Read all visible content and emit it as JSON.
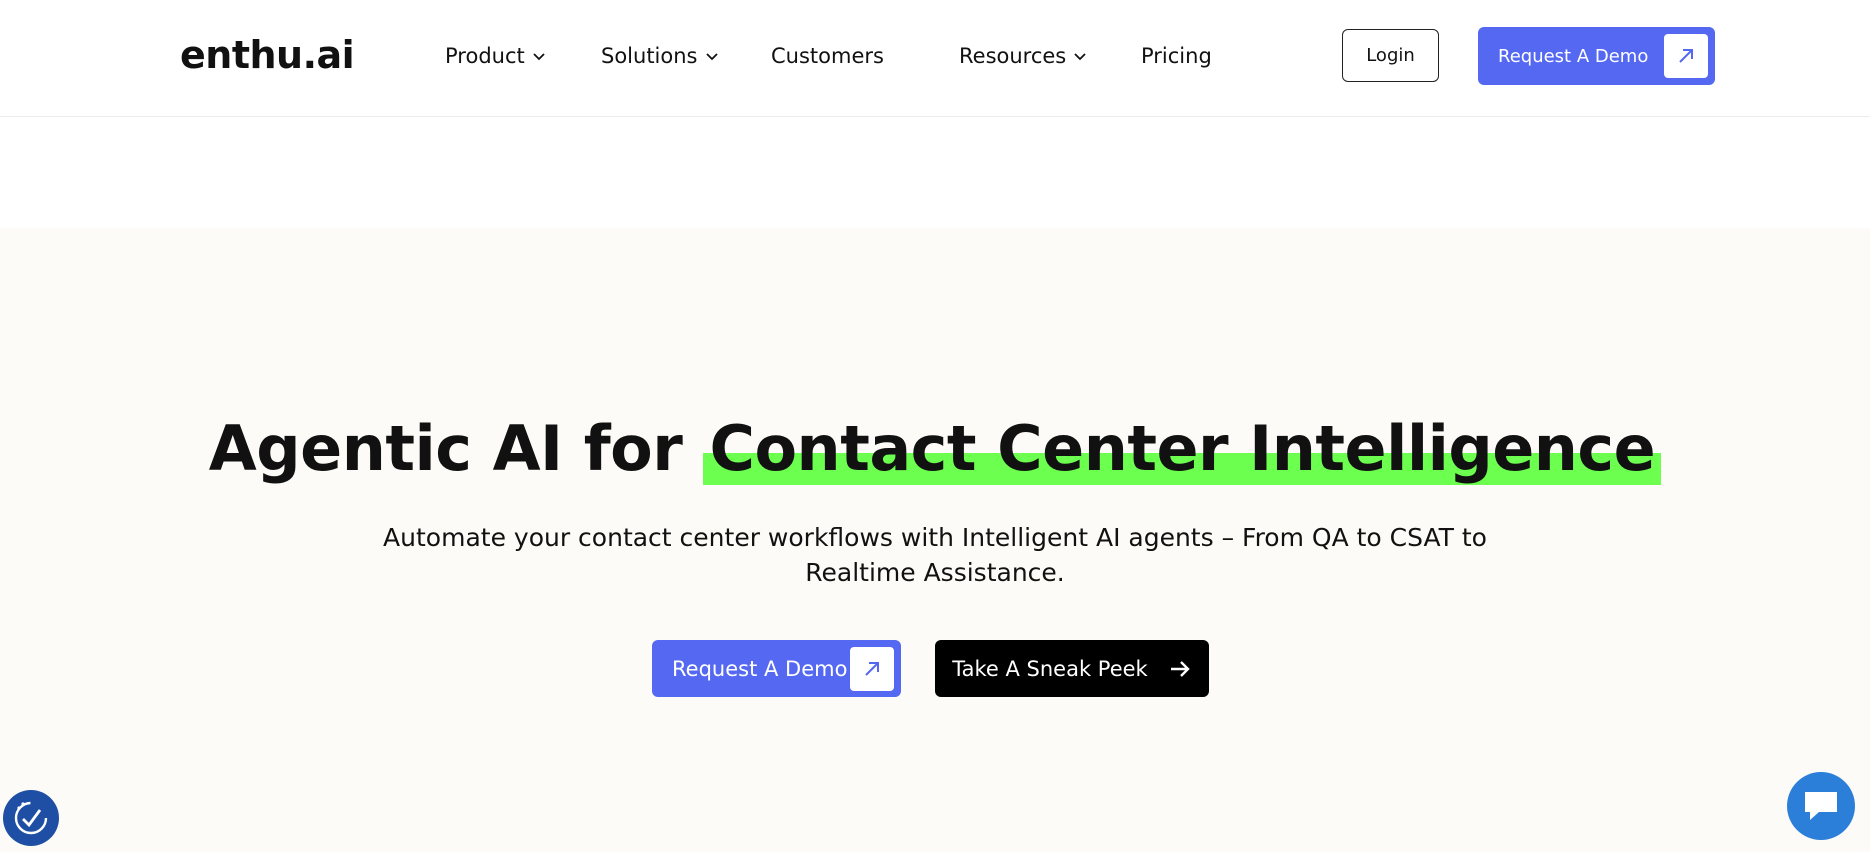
{
  "brand": {
    "logo_text": "enthu.ai"
  },
  "nav": {
    "items": [
      {
        "label": "Product",
        "has_dropdown": true
      },
      {
        "label": "Solutions",
        "has_dropdown": true
      },
      {
        "label": "Customers",
        "has_dropdown": false
      },
      {
        "label": "Resources",
        "has_dropdown": true
      },
      {
        "label": "Pricing",
        "has_dropdown": false
      }
    ],
    "login_label": "Login",
    "demo_label": "Request A Demo",
    "demo_icon": "arrow-up-right-icon"
  },
  "hero": {
    "headline_prefix": "Agentic AI for ",
    "headline_highlight": "Contact Center Intelligence",
    "subtitle": "Automate your contact center workflows with Intelligent AI agents – From QA to CSAT to Realtime Assistance.",
    "primary_cta": "Request A Demo",
    "secondary_cta": "Take A Sneak Peek",
    "secondary_icon": "arrow-right-icon"
  },
  "widgets": {
    "accessibility_icon": "accessibility-check-icon",
    "chat_icon": "chat-bubble-icon"
  },
  "colors": {
    "accent": "#5468f2",
    "highlight": "#6dff4f",
    "hero_background": "#fcfbf7",
    "chat": "#2b7fd8",
    "accessibility": "#1f4fa5"
  }
}
